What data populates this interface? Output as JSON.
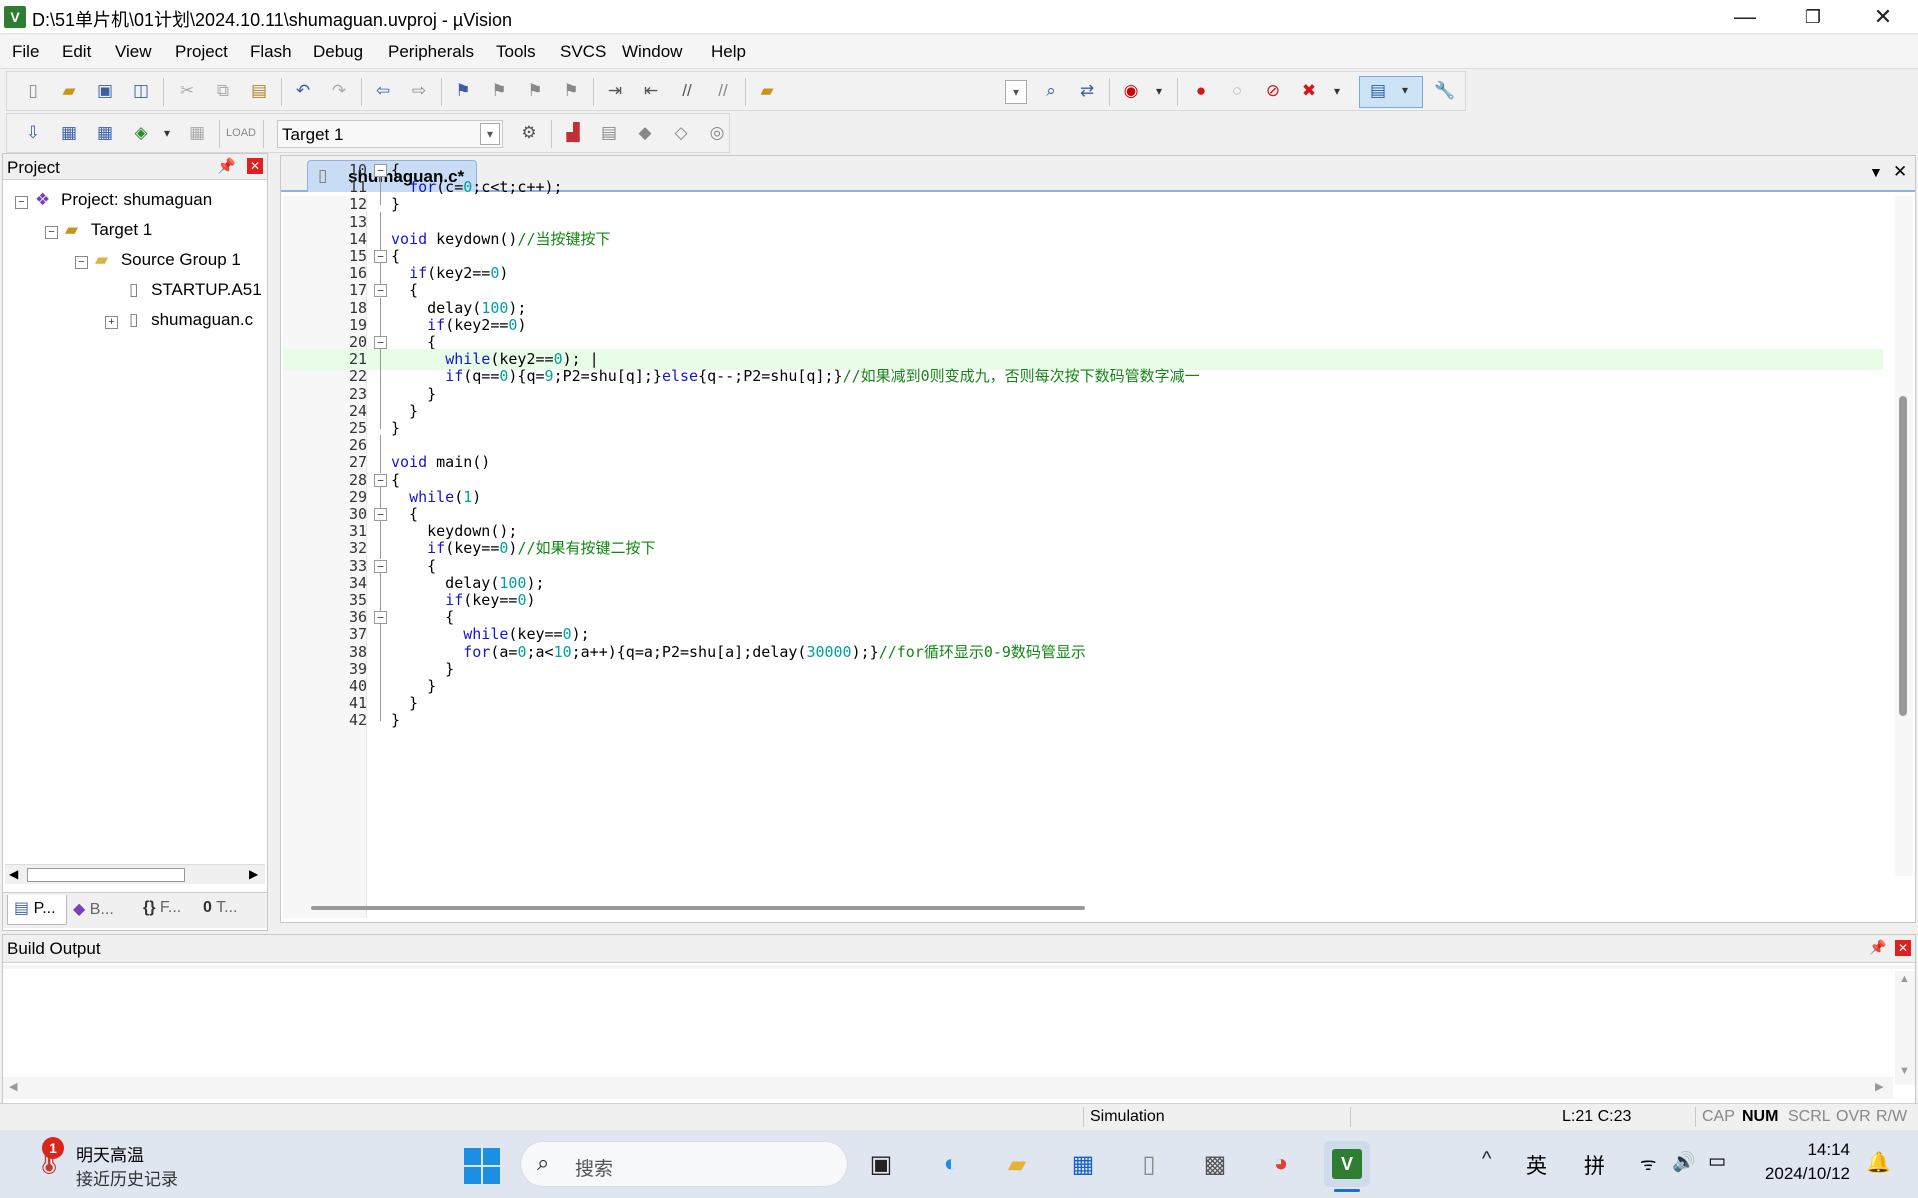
{
  "window": {
    "title": "D:\\51单片机\\01计划\\2024.10.11\\shumaguan.uvproj - µVision",
    "minimize": "—",
    "restore": "❐",
    "close": "✕"
  },
  "menu": [
    "File",
    "Edit",
    "View",
    "Project",
    "Flash",
    "Debug",
    "Peripherals",
    "Tools",
    "SVCS",
    "Window",
    "Help"
  ],
  "toolbar2": {
    "target": "Target 1"
  },
  "project_panel": {
    "title": "Project",
    "root": "Project: shumaguan",
    "target": "Target 1",
    "group": "Source Group 1",
    "files": [
      "STARTUP.A51",
      "shumaguan.c"
    ],
    "tabs": [
      "P...",
      "B...",
      "F...",
      "T..."
    ]
  },
  "editor": {
    "tab": "shumaguan.c*",
    "lines": [
      {
        "n": "10",
        "segs": [
          {
            "t": "{",
            "c": ""
          }
        ]
      },
      {
        "n": "11",
        "segs": [
          {
            "t": "  ",
            "c": ""
          },
          {
            "t": "for",
            "c": "kw"
          },
          {
            "t": "(c=",
            "c": ""
          },
          {
            "t": "0",
            "c": "num"
          },
          {
            "t": ";c<t;c++);",
            "c": ""
          }
        ]
      },
      {
        "n": "12",
        "segs": [
          {
            "t": "}",
            "c": ""
          }
        ]
      },
      {
        "n": "13",
        "segs": []
      },
      {
        "n": "14",
        "segs": [
          {
            "t": "void",
            "c": "kw"
          },
          {
            "t": " keydown()",
            "c": ""
          },
          {
            "t": "//当按键按下",
            "c": "cm"
          }
        ]
      },
      {
        "n": "15",
        "segs": [
          {
            "t": "{",
            "c": ""
          }
        ]
      },
      {
        "n": "16",
        "segs": [
          {
            "t": "  ",
            "c": ""
          },
          {
            "t": "if",
            "c": "kw"
          },
          {
            "t": "(key2==",
            "c": ""
          },
          {
            "t": "0",
            "c": "num"
          },
          {
            "t": ")",
            "c": ""
          }
        ]
      },
      {
        "n": "17",
        "segs": [
          {
            "t": "  {",
            "c": ""
          }
        ]
      },
      {
        "n": "18",
        "segs": [
          {
            "t": "    delay(",
            "c": ""
          },
          {
            "t": "100",
            "c": "num"
          },
          {
            "t": ");",
            "c": ""
          }
        ]
      },
      {
        "n": "19",
        "segs": [
          {
            "t": "    ",
            "c": ""
          },
          {
            "t": "if",
            "c": "kw"
          },
          {
            "t": "(key2==",
            "c": ""
          },
          {
            "t": "0",
            "c": "num"
          },
          {
            "t": ")",
            "c": ""
          }
        ]
      },
      {
        "n": "20",
        "segs": [
          {
            "t": "    {",
            "c": ""
          }
        ]
      },
      {
        "n": "21",
        "segs": [
          {
            "t": "      ",
            "c": ""
          },
          {
            "t": "while",
            "c": "kw"
          },
          {
            "t": "(key2==",
            "c": ""
          },
          {
            "t": "0",
            "c": "num"
          },
          {
            "t": "); |",
            "c": ""
          }
        ]
      },
      {
        "n": "22",
        "segs": [
          {
            "t": "      ",
            "c": ""
          },
          {
            "t": "if",
            "c": "kw"
          },
          {
            "t": "(q==",
            "c": ""
          },
          {
            "t": "0",
            "c": "num"
          },
          {
            "t": "){q=",
            "c": ""
          },
          {
            "t": "9",
            "c": "num"
          },
          {
            "t": ";P2=shu[q];}",
            "c": ""
          },
          {
            "t": "else",
            "c": "kw"
          },
          {
            "t": "{q--;P2=shu[q];}",
            "c": ""
          },
          {
            "t": "//如果减到0则变成九，否则每次按下数码管数字减一",
            "c": "cm"
          }
        ]
      },
      {
        "n": "23",
        "segs": [
          {
            "t": "    }",
            "c": ""
          }
        ]
      },
      {
        "n": "24",
        "segs": [
          {
            "t": "  }",
            "c": ""
          }
        ]
      },
      {
        "n": "25",
        "segs": [
          {
            "t": "}",
            "c": ""
          }
        ]
      },
      {
        "n": "26",
        "segs": []
      },
      {
        "n": "27",
        "segs": [
          {
            "t": "void",
            "c": "kw"
          },
          {
            "t": " main()",
            "c": ""
          }
        ]
      },
      {
        "n": "28",
        "segs": [
          {
            "t": "{",
            "c": ""
          }
        ]
      },
      {
        "n": "29",
        "segs": [
          {
            "t": "  ",
            "c": ""
          },
          {
            "t": "while",
            "c": "kw"
          },
          {
            "t": "(",
            "c": ""
          },
          {
            "t": "1",
            "c": "num"
          },
          {
            "t": ")",
            "c": ""
          }
        ]
      },
      {
        "n": "30",
        "segs": [
          {
            "t": "  {",
            "c": ""
          }
        ]
      },
      {
        "n": "31",
        "segs": [
          {
            "t": "    keydown();",
            "c": ""
          }
        ]
      },
      {
        "n": "32",
        "segs": [
          {
            "t": "    ",
            "c": ""
          },
          {
            "t": "if",
            "c": "kw"
          },
          {
            "t": "(key==",
            "c": ""
          },
          {
            "t": "0",
            "c": "num"
          },
          {
            "t": ")",
            "c": ""
          },
          {
            "t": "//如果有按键二按下",
            "c": "cm"
          }
        ]
      },
      {
        "n": "33",
        "segs": [
          {
            "t": "    {",
            "c": ""
          }
        ]
      },
      {
        "n": "34",
        "segs": [
          {
            "t": "      delay(",
            "c": ""
          },
          {
            "t": "100",
            "c": "num"
          },
          {
            "t": ");",
            "c": ""
          }
        ]
      },
      {
        "n": "35",
        "segs": [
          {
            "t": "      ",
            "c": ""
          },
          {
            "t": "if",
            "c": "kw"
          },
          {
            "t": "(key==",
            "c": ""
          },
          {
            "t": "0",
            "c": "num"
          },
          {
            "t": ")",
            "c": ""
          }
        ]
      },
      {
        "n": "36",
        "segs": [
          {
            "t": "      {",
            "c": ""
          }
        ]
      },
      {
        "n": "37",
        "segs": [
          {
            "t": "        ",
            "c": ""
          },
          {
            "t": "while",
            "c": "kw"
          },
          {
            "t": "(key==",
            "c": ""
          },
          {
            "t": "0",
            "c": "num"
          },
          {
            "t": ");",
            "c": ""
          }
        ]
      },
      {
        "n": "38",
        "segs": [
          {
            "t": "        ",
            "c": ""
          },
          {
            "t": "for",
            "c": "kw"
          },
          {
            "t": "(a=",
            "c": ""
          },
          {
            "t": "0",
            "c": "num"
          },
          {
            "t": ";a<",
            "c": ""
          },
          {
            "t": "10",
            "c": "num"
          },
          {
            "t": ";a++){q=a;P2=shu[a];delay(",
            "c": ""
          },
          {
            "t": "30000",
            "c": "num"
          },
          {
            "t": ");}",
            "c": ""
          },
          {
            "t": "//for循环显示0-9数码管显示",
            "c": "cm"
          }
        ]
      },
      {
        "n": "39",
        "segs": [
          {
            "t": "      }",
            "c": ""
          }
        ]
      },
      {
        "n": "40",
        "segs": [
          {
            "t": "    }",
            "c": ""
          }
        ]
      },
      {
        "n": "41",
        "segs": [
          {
            "t": "  }",
            "c": ""
          }
        ]
      },
      {
        "n": "42",
        "segs": [
          {
            "t": "}",
            "c": ""
          }
        ]
      }
    ]
  },
  "build_output": {
    "title": "Build Output"
  },
  "status": {
    "mode": "Simulation",
    "position": "L:21 C:23",
    "cap": "CAP",
    "num": "NUM",
    "scrl": "SCRL",
    "ovr": "OVR",
    "rw": "R/W"
  },
  "taskbar": {
    "weather_title": "明天高温",
    "weather_sub": "接近历史记录",
    "badge": "1",
    "search": "搜索",
    "ime1": "英",
    "ime2": "拼",
    "time": "14:14",
    "date": "2024/10/12"
  },
  "colors": {
    "keyword": "#1515d0",
    "number": "#00a0a0",
    "comment": "#118811",
    "current_line": "#e8fde8"
  }
}
